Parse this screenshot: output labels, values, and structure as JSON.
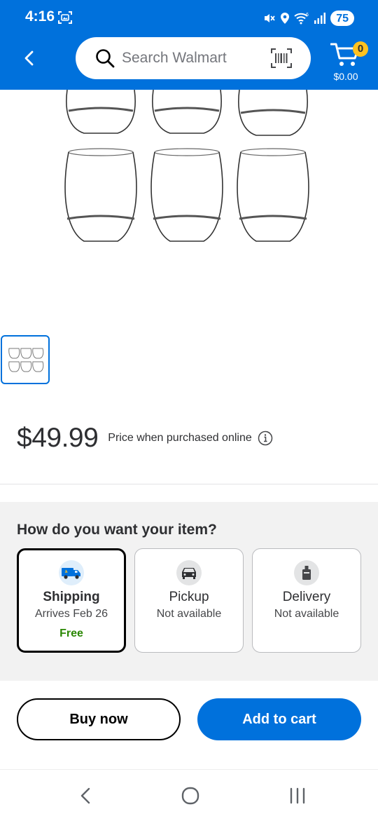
{
  "status_bar": {
    "time": "4:16",
    "battery": "75"
  },
  "search": {
    "placeholder": "Search Walmart"
  },
  "cart": {
    "count": "0",
    "total": "$0.00"
  },
  "price": {
    "amount": "$49.99",
    "note": "Price when purchased online"
  },
  "fulfillment": {
    "title": "How do you want your item?",
    "options": [
      {
        "name": "Shipping",
        "sub": "Arrives Feb 26",
        "extra": "Free"
      },
      {
        "name": "Pickup",
        "sub": "Not available"
      },
      {
        "name": "Delivery",
        "sub": "Not available"
      }
    ]
  },
  "actions": {
    "buy_now": "Buy now",
    "add_to_cart": "Add to cart"
  },
  "colors": {
    "brand_blue": "#0071dc",
    "cart_badge": "#ffc220",
    "free_green": "#2a8703"
  },
  "icons": [
    "screenshot-icon",
    "mute-icon",
    "location-icon",
    "wifi-icon",
    "signal-icon",
    "back-icon",
    "search-icon",
    "barcode-icon",
    "cart-icon",
    "info-icon",
    "truck-icon",
    "car-icon",
    "bag-icon",
    "nav-back-icon",
    "nav-home-icon",
    "nav-recents-icon"
  ]
}
